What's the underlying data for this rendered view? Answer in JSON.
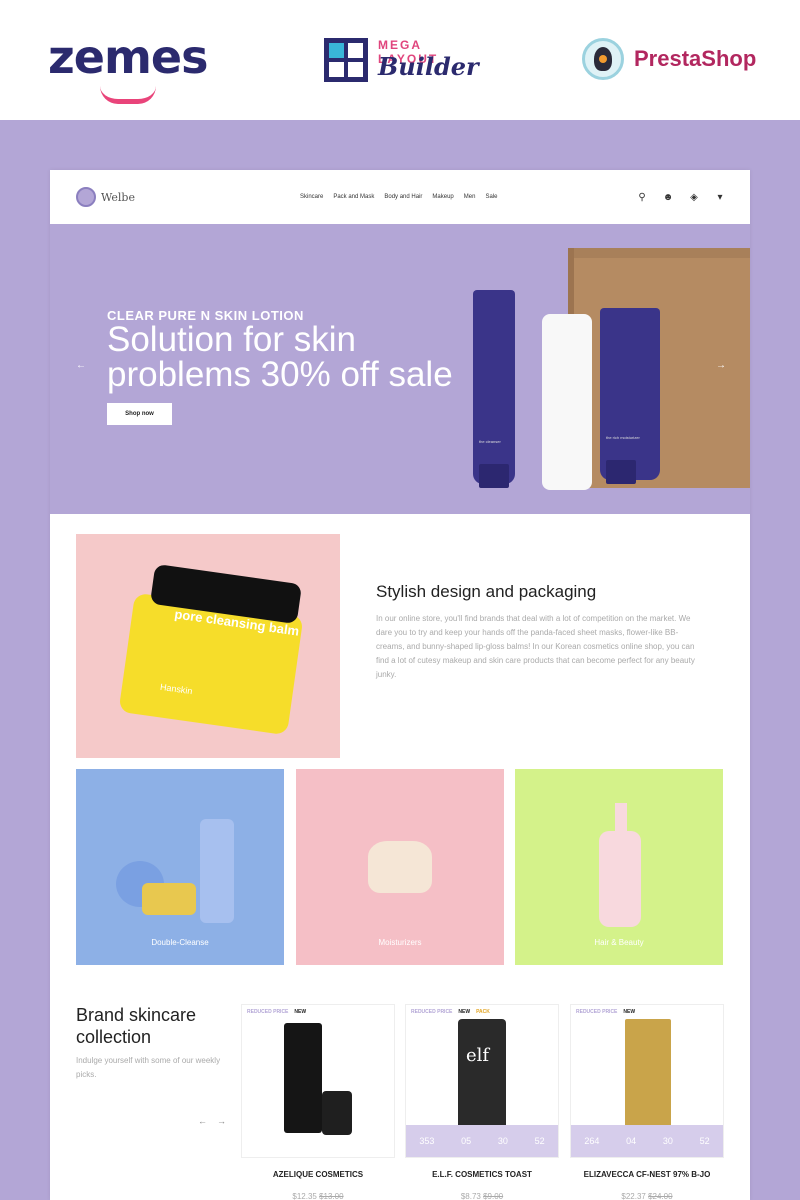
{
  "banner": {
    "zemes_logo": "zemes",
    "mega_top": "MEGA LAYOUT",
    "mega_bottom": "Builder",
    "prestashop": "PrestaShop"
  },
  "nav": {
    "brand": "Welbe",
    "menu": [
      "Skincare",
      "Pack and Mask",
      "Body and Hair",
      "Makeup",
      "Men",
      "Sale"
    ],
    "icons": [
      "search-icon",
      "account-icon",
      "cart-icon",
      "settings-icon"
    ]
  },
  "hero": {
    "subtitle": "CLEAR PURE N SKIN LOTION",
    "title": "Solution for skin problems 30% off sale",
    "button": "Shop now",
    "prev": "←",
    "next": "→",
    "tube1_label": "the cleanser",
    "tube2_label": "the rich moisturizer"
  },
  "feature": {
    "jar_text": "pore cleansing balm",
    "jar_brand": "Hanskin",
    "title": "Stylish design and packaging",
    "text": "In our online store, you'll find brands that deal with a lot of competition on the market. We dare you to try and keep your hands off the panda-faced sheet masks, flower-like BB-creams, and bunny-shaped lip-gloss balms! In our Korean cosmetics online shop, you can find a lot of cutesy makeup and skin care products that can become perfect for any beauty junky."
  },
  "categories": [
    "Double-Cleanse",
    "Moisturizers",
    "Hair & Beauty"
  ],
  "collection": {
    "title": "Brand skincare collection",
    "text": "Indulge yourself with some of our weekly picks.",
    "prev": "←",
    "next": "→",
    "products": [
      {
        "name": "AZELIQUE COSMETICS",
        "price": "$12.35",
        "old_price": "$13.00",
        "tags": [
          "REDUCED PRICE",
          "NEW"
        ],
        "countdown": []
      },
      {
        "name": "E.L.F. COSMETICS TOAST",
        "price": "$8.73",
        "old_price": "$9.00",
        "tags": [
          "REDUCED PRICE",
          "NEW",
          "PACK"
        ],
        "countdown": [
          "353",
          "05",
          "30",
          "52"
        ],
        "label": "elf"
      },
      {
        "name": "ELIZAVECCA CF-NEST 97% B-JO",
        "price": "$22.37",
        "old_price": "$24.00",
        "tags": [
          "REDUCED PRICE",
          "NEW"
        ],
        "countdown": [
          "264",
          "04",
          "30",
          "52"
        ]
      }
    ]
  },
  "colors": {
    "backdrop": "#b3a6d6",
    "accent": "#2b2a6e",
    "pink": "#e9447a"
  }
}
